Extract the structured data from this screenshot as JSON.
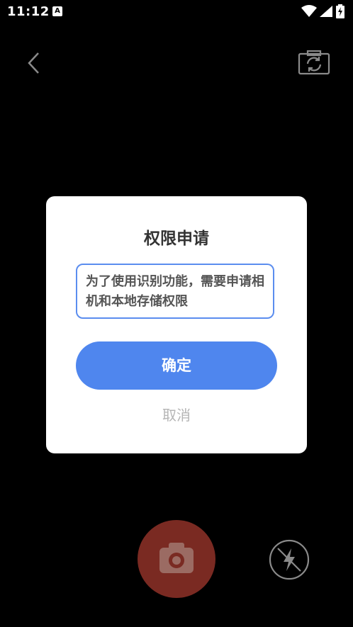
{
  "status_bar": {
    "time": "11:12",
    "notification_icon": "a-icon",
    "icons": [
      "wifi-icon",
      "signal-icon",
      "battery-icon"
    ]
  },
  "toolbar": {
    "back_icon": "chevron-left-icon",
    "switch_camera_icon": "camera-switch-icon"
  },
  "dialog": {
    "title": "权限申请",
    "message": "为了使用识别功能，需要申请相机和本地存储权限",
    "confirm_label": "确定",
    "cancel_label": "取消"
  },
  "camera_controls": {
    "shutter_icon": "camera-icon",
    "flash_icon": "flash-off-icon"
  },
  "colors": {
    "accent": "#4f86ee",
    "dialog_border": "#5b8def",
    "cancel_text": "#b5b5b5",
    "shutter": "#7a2a22"
  }
}
